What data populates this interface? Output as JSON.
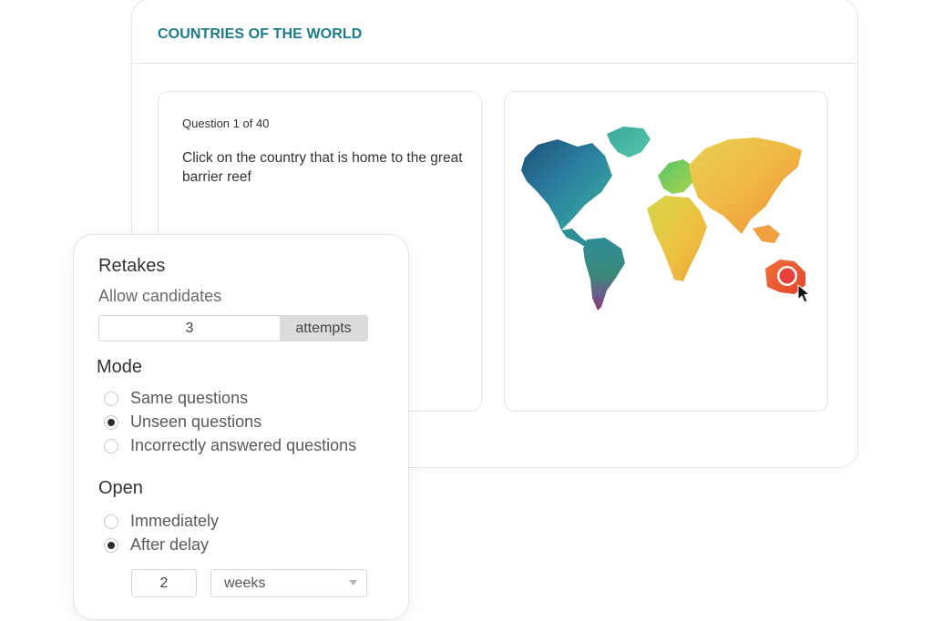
{
  "quiz": {
    "title": "COUNTRIES OF THE WORLD",
    "question_counter": "Question 1 of 40",
    "question_text": "Click on the country that is home to the great barrier reef"
  },
  "settings": {
    "retakes_title": "Retakes",
    "allow_label": "Allow candidates",
    "attempts_value": "3",
    "attempts_unit": "attempts",
    "mode_title": "Mode",
    "mode_options": [
      {
        "label": "Same questions",
        "checked": false
      },
      {
        "label": "Unseen questions",
        "checked": true
      },
      {
        "label": "Incorrectly answered questions",
        "checked": false
      }
    ],
    "open_title": "Open",
    "open_options": [
      {
        "label": "Immediately",
        "checked": false
      },
      {
        "label": "After delay",
        "checked": true
      }
    ],
    "delay_value": "2",
    "delay_unit": "weeks"
  },
  "colors": {
    "accent": "#1b7b8a",
    "marker": "#e8403a"
  },
  "icons": [
    "map-marker-icon",
    "cursor-arrow-icon",
    "chevron-down-icon"
  ]
}
